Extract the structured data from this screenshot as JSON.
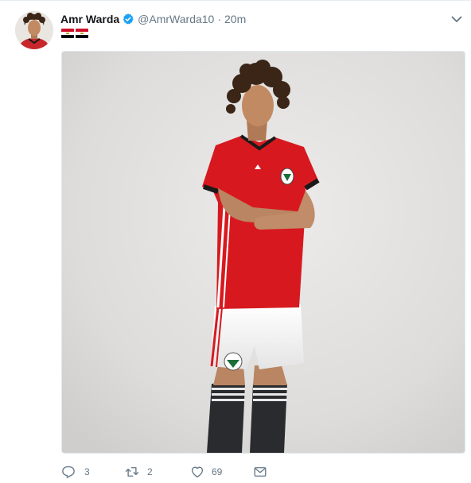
{
  "tweet": {
    "author_name": "Amr Warda",
    "handle": "@AmrWarda10",
    "separator": "·",
    "time": "20m",
    "verified": true,
    "bio_flags": [
      "egypt-flag",
      "egypt-flag"
    ],
    "media": {
      "description_icon": "photo"
    },
    "actions": {
      "reply_count": "3",
      "retweet_count": "2",
      "like_count": "69"
    }
  },
  "colors": {
    "name": "#14171a",
    "secondary": "#657786",
    "verified": "#1da1f2",
    "border": "#e1e8ed",
    "flag_red": "#ce1126",
    "flag_black": "#000000",
    "flag_gold": "#c09300",
    "jersey_red": "#d7191f"
  }
}
